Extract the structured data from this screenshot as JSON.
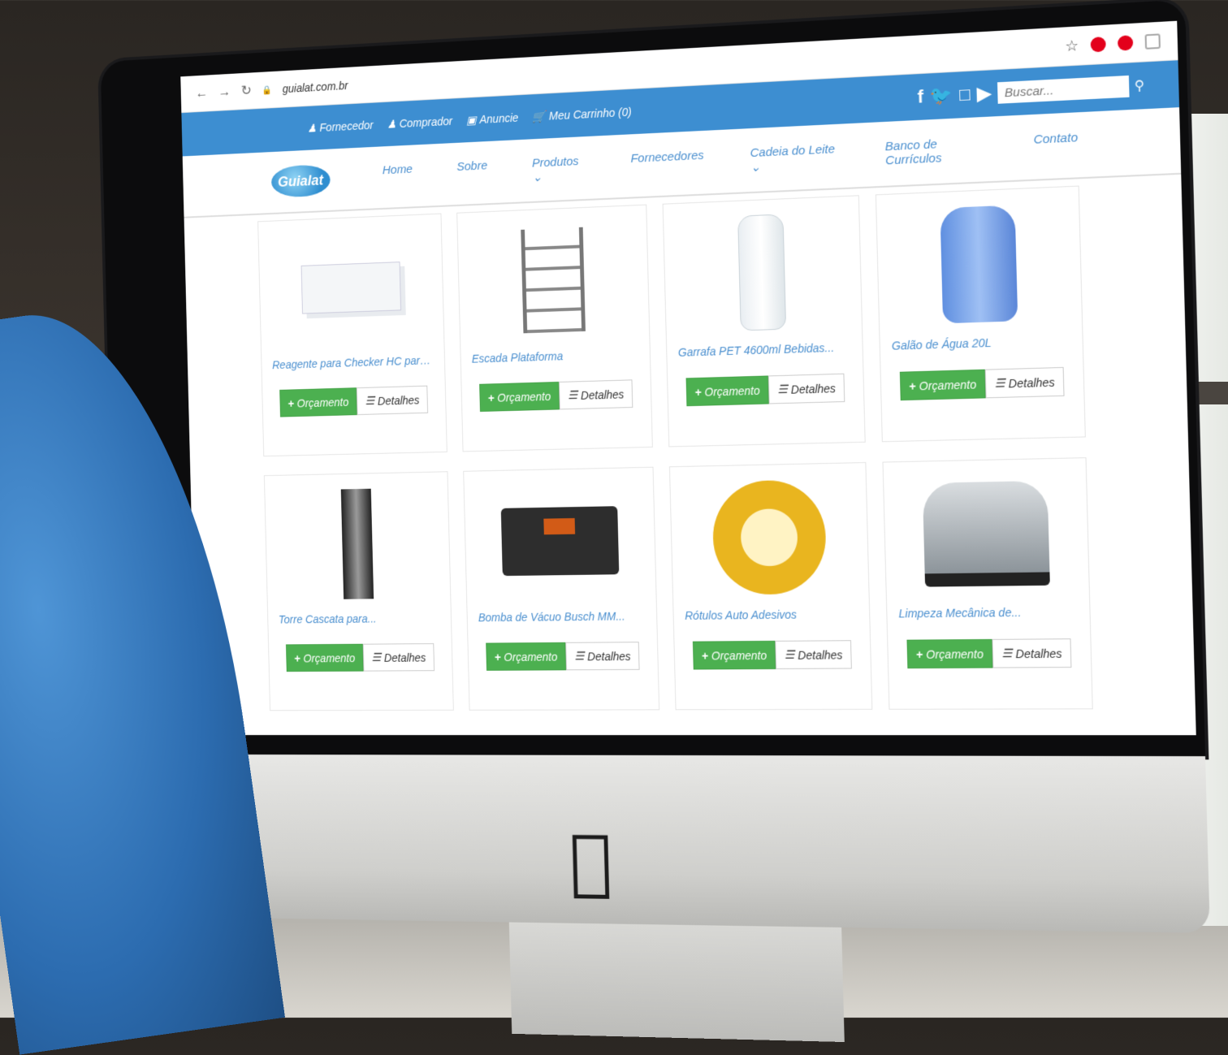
{
  "browser": {
    "url": "guialat.com.br"
  },
  "topbar": {
    "links": [
      {
        "label": "Fornecedor",
        "icon": "user-icon"
      },
      {
        "label": "Comprador",
        "icon": "user-icon"
      },
      {
        "label": "Anuncie",
        "icon": "image-icon"
      },
      {
        "label": "Meu Carrinho (0)",
        "icon": "cart-icon"
      }
    ],
    "social": [
      "facebook-icon",
      "twitter-icon",
      "instagram-icon",
      "youtube-icon"
    ],
    "search_placeholder": "Buscar..."
  },
  "logo": {
    "text": "Guialat"
  },
  "nav": {
    "items": [
      "Home",
      "Sobre",
      "Produtos",
      "Fornecedores",
      "Cadeia do Leite",
      "Banco de Currículos",
      "Contato"
    ]
  },
  "products": [
    {
      "title": "Reagente para Checker HC para...",
      "shape": "sachet"
    },
    {
      "title": "Escada Plataforma",
      "shape": "ladder"
    },
    {
      "title": "Garrafa PET 4600ml Bebidas...",
      "shape": "bottle"
    },
    {
      "title": "Galão de Água 20L",
      "shape": "gallon"
    },
    {
      "title": "Torre Cascata para...",
      "shape": "tower"
    },
    {
      "title": "Bomba de Vácuo Busch MM...",
      "shape": "pump"
    },
    {
      "title": "Rótulos Auto Adesivos",
      "shape": "cheese"
    },
    {
      "title": "Limpeza Mecânica de...",
      "shape": "tank"
    }
  ],
  "buttons": {
    "orcamento": "Orçamento",
    "detalhes": "Detalhes"
  },
  "colors": {
    "topbar": "#3d8ed1",
    "link": "#4a8fcf",
    "button_green": "#4cb050"
  }
}
